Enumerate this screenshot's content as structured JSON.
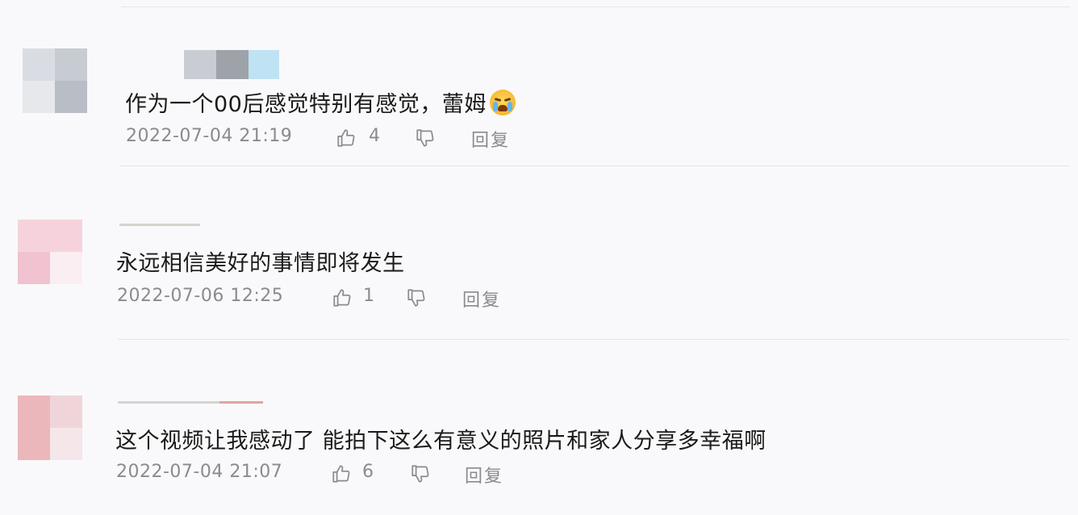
{
  "comments": [
    {
      "text": "作为一个00后感觉特别有感觉，蕾姆",
      "emoji": "loudly-crying-face",
      "time": "2022-07-04 21:19",
      "likes": "4",
      "reply_label": "回复"
    },
    {
      "text": "永远相信美好的事情即将发生",
      "time": "2022-07-06 12:25",
      "likes": "1",
      "reply_label": "回复"
    },
    {
      "text": "这个视频让我感动了 能拍下这么有意义的照片和家人分享多幸福啊",
      "time": "2022-07-04 21:07",
      "likes": "6",
      "reply_label": "回复"
    }
  ],
  "icons": {
    "like": "thumbs-up-icon",
    "dislike": "thumbs-down-icon"
  },
  "colors": {
    "text": "#1a1a1a",
    "meta": "#8a8a90",
    "divider": "#e6e6ea",
    "background": "#f9f9fb"
  }
}
